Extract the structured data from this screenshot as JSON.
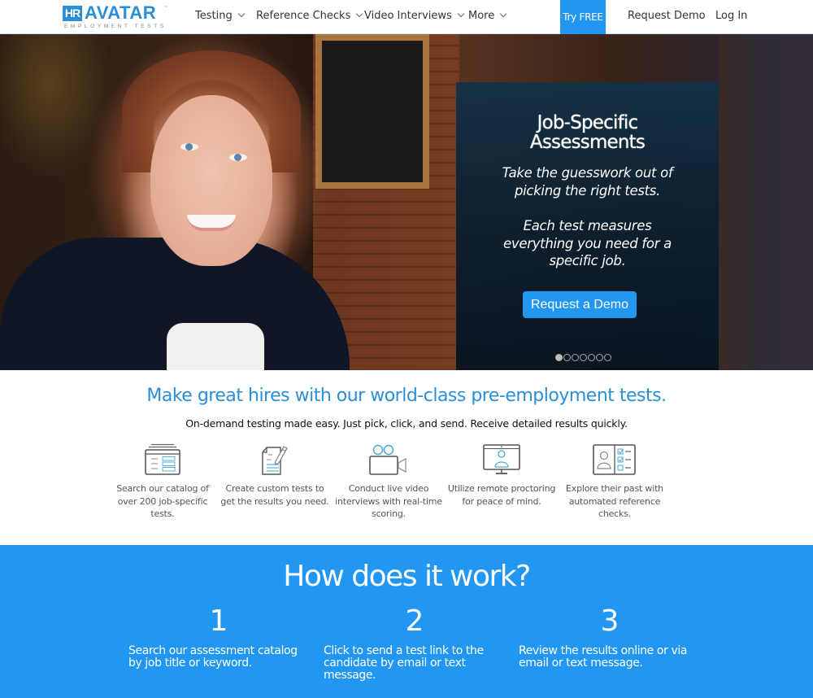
{
  "brand": {
    "logo_badge": "HR",
    "logo_word": "AVATAR",
    "logo_tm": "™",
    "logo_sub": "EMPLOYMENT TESTS",
    "accent_color": "#2196f3",
    "logo_color": "#2a8fd8"
  },
  "nav": {
    "items": [
      {
        "label": "Testing",
        "has_dropdown": true
      },
      {
        "label": "Reference Checks",
        "has_dropdown": true
      },
      {
        "label": "Video Interviews",
        "has_dropdown": true
      },
      {
        "label": "More",
        "has_dropdown": true
      }
    ],
    "try_free": "Try FREE",
    "request_demo": "Request Demo",
    "log_in": "Log In"
  },
  "hero": {
    "image_alt": "Smiling woman in dark blazer",
    "title_line1": "Job-Specific",
    "title_line2": "Assessments",
    "sub1_line1": "Take the guesswork out of",
    "sub1_line2": "picking the right tests.",
    "sub2_line1": "Each test measures",
    "sub2_line2": "everything you need for a",
    "sub2_line3": "specific job.",
    "cta": "Request a Demo",
    "slides_total": 7,
    "active_slide": 1
  },
  "intro": {
    "headline": "Make great hires with our world-class pre-employment tests.",
    "subline": "On-demand testing made easy. Just pick, click, and send. Receive detailed results quickly."
  },
  "features": [
    {
      "icon": "catalog-icon",
      "line1": "Search our catalog of",
      "line2": "over 200 job-specific",
      "line3": "tests."
    },
    {
      "icon": "custom-test-icon",
      "line1": "Create custom tests to",
      "line2": "get the results you need.",
      "line3": ""
    },
    {
      "icon": "video-camera-icon",
      "line1": "Conduct live video",
      "line2": "interviews with real-time",
      "line3": "scoring."
    },
    {
      "icon": "remote-proctoring-icon",
      "line1": "Utilize remote proctoring",
      "line2": "for peace of mind.",
      "line3": ""
    },
    {
      "icon": "reference-check-icon",
      "line1": "Explore their past with",
      "line2": "automated reference",
      "line3": "checks."
    }
  ],
  "how": {
    "title": "How does it work?",
    "steps": [
      {
        "num": "1",
        "line1": "Search our assessment catalog",
        "line2": "by job title or keyword.",
        "line3": ""
      },
      {
        "num": "2",
        "line1": "Click to send a test link to the",
        "line2": "candidate by email or text",
        "line3": "message."
      },
      {
        "num": "3",
        "line1": "Review the results online or via",
        "line2": "email or text message.",
        "line3": ""
      }
    ]
  }
}
